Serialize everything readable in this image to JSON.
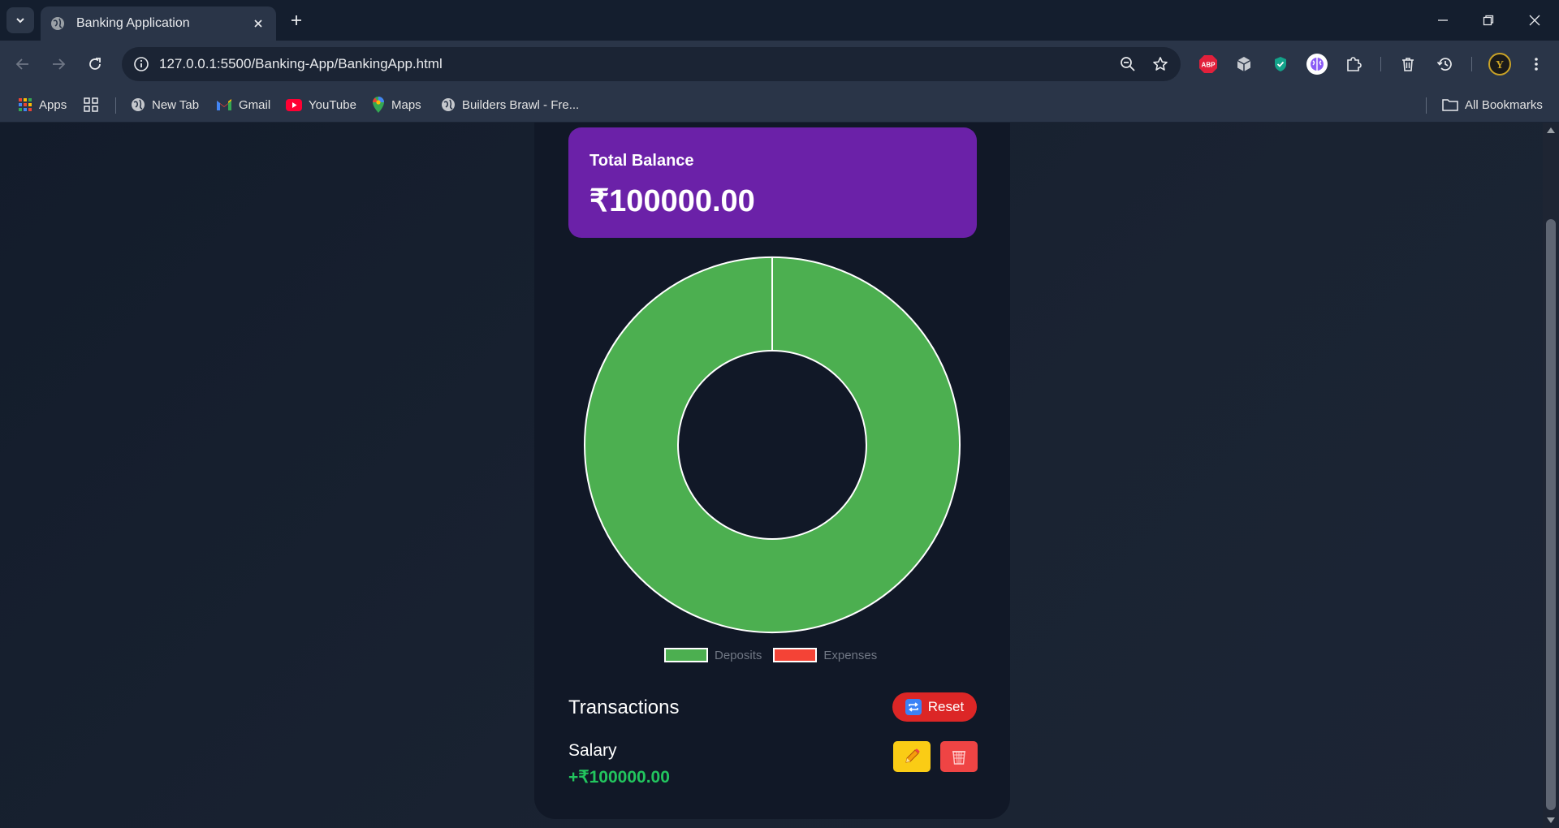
{
  "browser": {
    "tab": {
      "title": "Banking Application"
    },
    "url": "127.0.0.1:5500/Banking-App/BankingApp.html",
    "extensions": [
      "adblock-plus-icon",
      "cube-extension-icon",
      "shield-extension-icon",
      "brain-extension-icon",
      "puzzle-icon",
      "trash-icon",
      "history-icon",
      "profile-icon"
    ],
    "bookmarks": {
      "apps": "Apps",
      "items": [
        {
          "label": "New Tab",
          "icon": "globe-icon"
        },
        {
          "label": "Gmail",
          "icon": "gmail-icon"
        },
        {
          "label": "YouTube",
          "icon": "youtube-icon"
        },
        {
          "label": "Maps",
          "icon": "maps-icon"
        },
        {
          "label": "Builders Brawl - Fre...",
          "icon": "globe-icon"
        }
      ],
      "all_bookmarks": "All Bookmarks"
    }
  },
  "app": {
    "balance": {
      "label": "Total Balance",
      "amount": "₹100000.00"
    },
    "transactions": {
      "title": "Transactions",
      "reset_label": "Reset",
      "items": [
        {
          "name": "Salary",
          "amount": "+₹100000.00",
          "type": "deposit"
        }
      ]
    },
    "colors": {
      "balance_card": "#6b21a8",
      "deposits": "#4caf50",
      "expenses": "#f44336",
      "reset": "#dc2626",
      "edit": "#facc15",
      "delete": "#ef4444",
      "positive_amount": "#22c55e"
    }
  },
  "chart_data": {
    "type": "pie",
    "variant": "doughnut",
    "categories": [
      "Deposits",
      "Expenses"
    ],
    "values": [
      100000,
      0
    ],
    "colors": [
      "#4caf50",
      "#f44336"
    ],
    "legend": "bottom"
  }
}
